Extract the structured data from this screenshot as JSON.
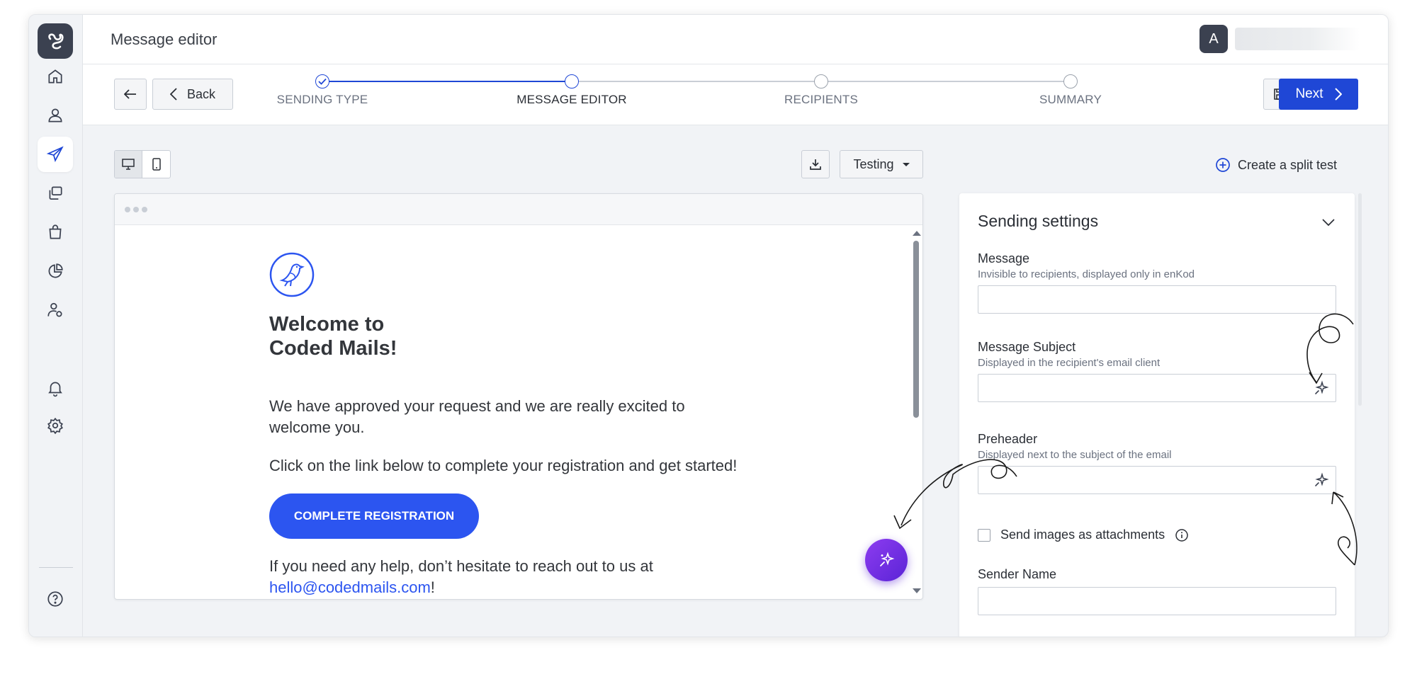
{
  "header": {
    "title": "Message editor",
    "avatar_initial": "A"
  },
  "stepper": {
    "back_label": "Back",
    "next_label": "Next",
    "steps": [
      {
        "label": "SENDING TYPE",
        "state": "done"
      },
      {
        "label": "MESSAGE EDITOR",
        "state": "current"
      },
      {
        "label": "RECIPIENTS",
        "state": "upcoming"
      },
      {
        "label": "SUMMARY",
        "state": "upcoming"
      }
    ]
  },
  "toolbar": {
    "testing_label": "Testing",
    "split_test_label": "Create a split test"
  },
  "email": {
    "heading": "Welcome to\nCoded Mails!",
    "paragraph1": "We have approved your request and we are really excited to welcome you.",
    "paragraph2": "Click on the link below to complete your registration and get started!",
    "cta_label": "COMPLETE REGISTRATION",
    "paragraph3_prefix": "If you need any help, don’t hesitate to reach out to us at",
    "contact_email": "hello@codedmails.com",
    "paragraph3_suffix": "!"
  },
  "settings": {
    "title": "Sending settings",
    "message": {
      "label": "Message",
      "help": "Invisible to recipients, displayed only in enKod",
      "value": ""
    },
    "subject": {
      "label": "Message Subject",
      "help": "Displayed in the recipient's email client",
      "value": ""
    },
    "preheader": {
      "label": "Preheader",
      "help": "Displayed next to the subject of the email",
      "value": ""
    },
    "attachments_label": "Send images as attachments",
    "sender_name": {
      "label": "Sender Name",
      "value": ""
    }
  },
  "icons": {
    "nav": [
      "home-icon",
      "user-icon",
      "send-icon",
      "copy-icon",
      "bag-icon",
      "pie-chart-icon",
      "user-settings-icon",
      "bell-icon",
      "gear-icon",
      "help-icon"
    ],
    "brand_logo": "bird-icon",
    "ai": "sparkle-icon"
  },
  "colors": {
    "primary": "#1f47d6",
    "email_accent": "#2c55f0",
    "ai_gradient_start": "#8d3cf0",
    "ai_gradient_end": "#5a24d6",
    "sidebar_dark": "#3b4150"
  }
}
